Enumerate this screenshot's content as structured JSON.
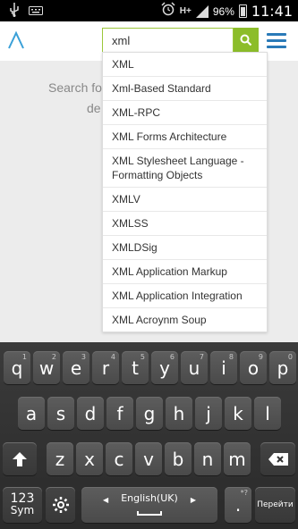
{
  "status_bar": {
    "left_icons": [
      "usb-icon",
      "keyboard-icon"
    ],
    "right_icons": [
      "alarm-icon",
      "hplus-data-icon",
      "signal-icon",
      "battery-icon"
    ],
    "battery_percent": "96%",
    "time": "11:41",
    "data_label": "H+"
  },
  "header": {
    "search_value": "xml"
  },
  "background": {
    "line1": "Search fo",
    "line2": "de"
  },
  "suggestions": [
    "XML",
    "Xml-Based Standard",
    "XML-RPC",
    "XML Forms Architecture",
    "XML Stylesheet Language - Formatting Objects",
    "XMLV",
    "XMLSS",
    "XMLDSig",
    "XML Application Markup",
    "XML Application Integration",
    "XML Acroynm Soup"
  ],
  "keyboard": {
    "row1": [
      {
        "k": "q",
        "alt": "1"
      },
      {
        "k": "w",
        "alt": "2"
      },
      {
        "k": "e",
        "alt": "3"
      },
      {
        "k": "r",
        "alt": "4"
      },
      {
        "k": "t",
        "alt": "5"
      },
      {
        "k": "y",
        "alt": "6"
      },
      {
        "k": "u",
        "alt": "7"
      },
      {
        "k": "i",
        "alt": "8"
      },
      {
        "k": "o",
        "alt": "9"
      },
      {
        "k": "p",
        "alt": "0"
      }
    ],
    "row2": [
      "a",
      "s",
      "d",
      "f",
      "g",
      "h",
      "j",
      "k",
      "l"
    ],
    "row3": [
      "z",
      "x",
      "c",
      "v",
      "b",
      "n",
      "m"
    ],
    "sym_label_1": "123",
    "sym_label_2": "Sym",
    "space_label": "English(UK)",
    "period_label": ".",
    "period_alt": "*?",
    "go_label": "Перейти"
  },
  "colors": {
    "accent_green": "#8cbd2a",
    "menu_blue": "#2a7ab8",
    "logo_blue": "#3aa0d8"
  }
}
